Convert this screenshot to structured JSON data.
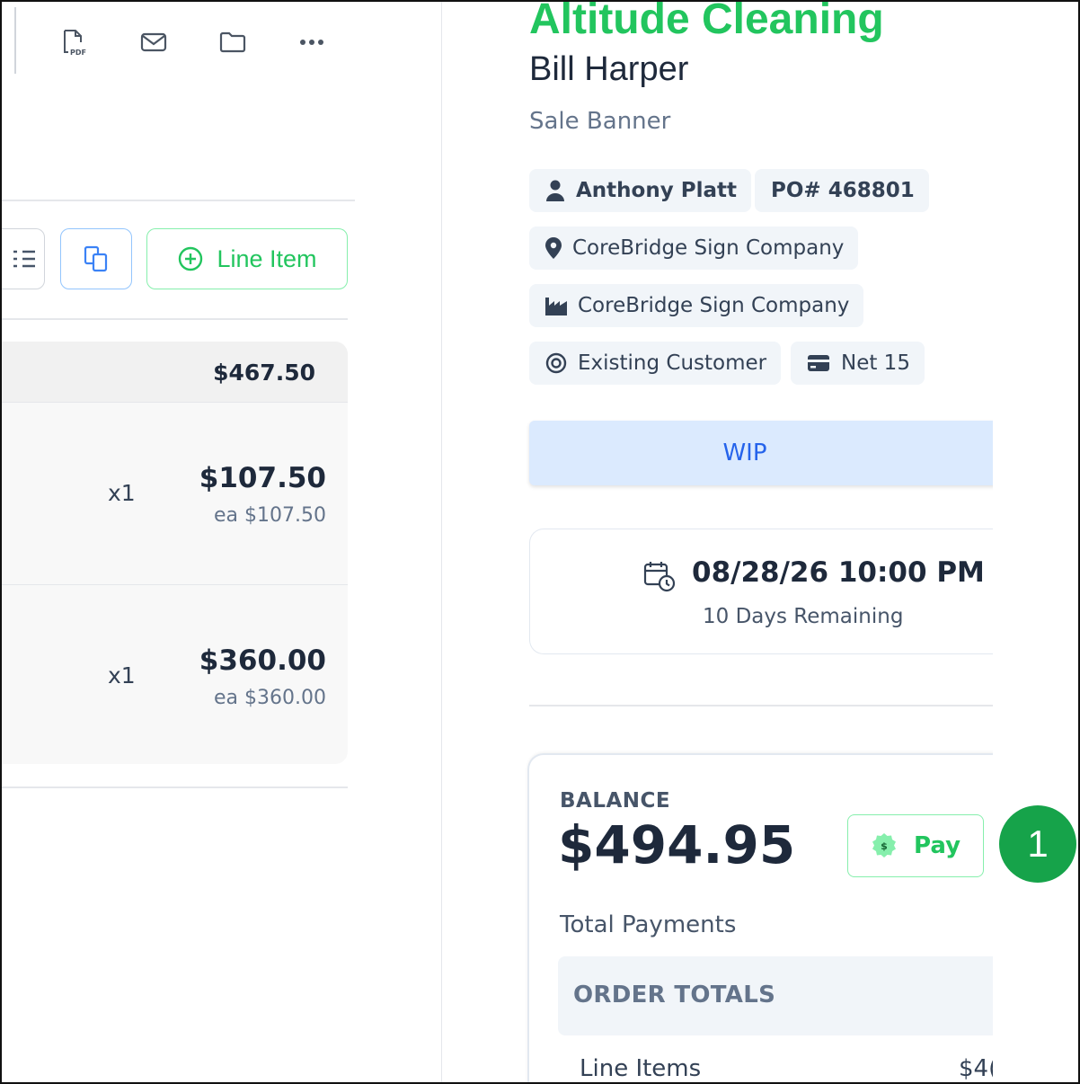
{
  "toolbar": {
    "icons": [
      "pdf-icon",
      "mail-icon",
      "folder-icon",
      "more-icon"
    ]
  },
  "actions": {
    "line_item_label": "Line Item"
  },
  "line_items": {
    "total": "$467.50",
    "rows": [
      {
        "qty": "x1",
        "price": "$107.50",
        "each": "ea $107.50"
      },
      {
        "qty": "x1",
        "price": "$360.00",
        "each": "ea $360.00"
      }
    ]
  },
  "order": {
    "company": "Altitude Cleaning",
    "contact": "Bill Harper",
    "name": "Sale Banner",
    "salesperson": "Anthony Platt",
    "po": "PO# 468801",
    "location": "CoreBridge Sign Company",
    "production": "CoreBridge Sign Company",
    "origin": "Existing Customer",
    "terms": "Net 15",
    "status": "WIP",
    "due_date": "08/28/26 10:00 PM",
    "due_remaining": "10 Days Remaining"
  },
  "balance": {
    "label": "BALANCE",
    "amount": "$494.95",
    "pay_label": "Pay",
    "total_payments_label": "Total Payments",
    "order_totals_label": "ORDER TOTALS",
    "line_items_label": "Line Items",
    "line_items_value": "$4("
  },
  "callout": {
    "number": "1"
  },
  "colors": {
    "brand_green": "#22c55e",
    "status_blue": "#2563eb",
    "callout_green": "#16a34a"
  }
}
